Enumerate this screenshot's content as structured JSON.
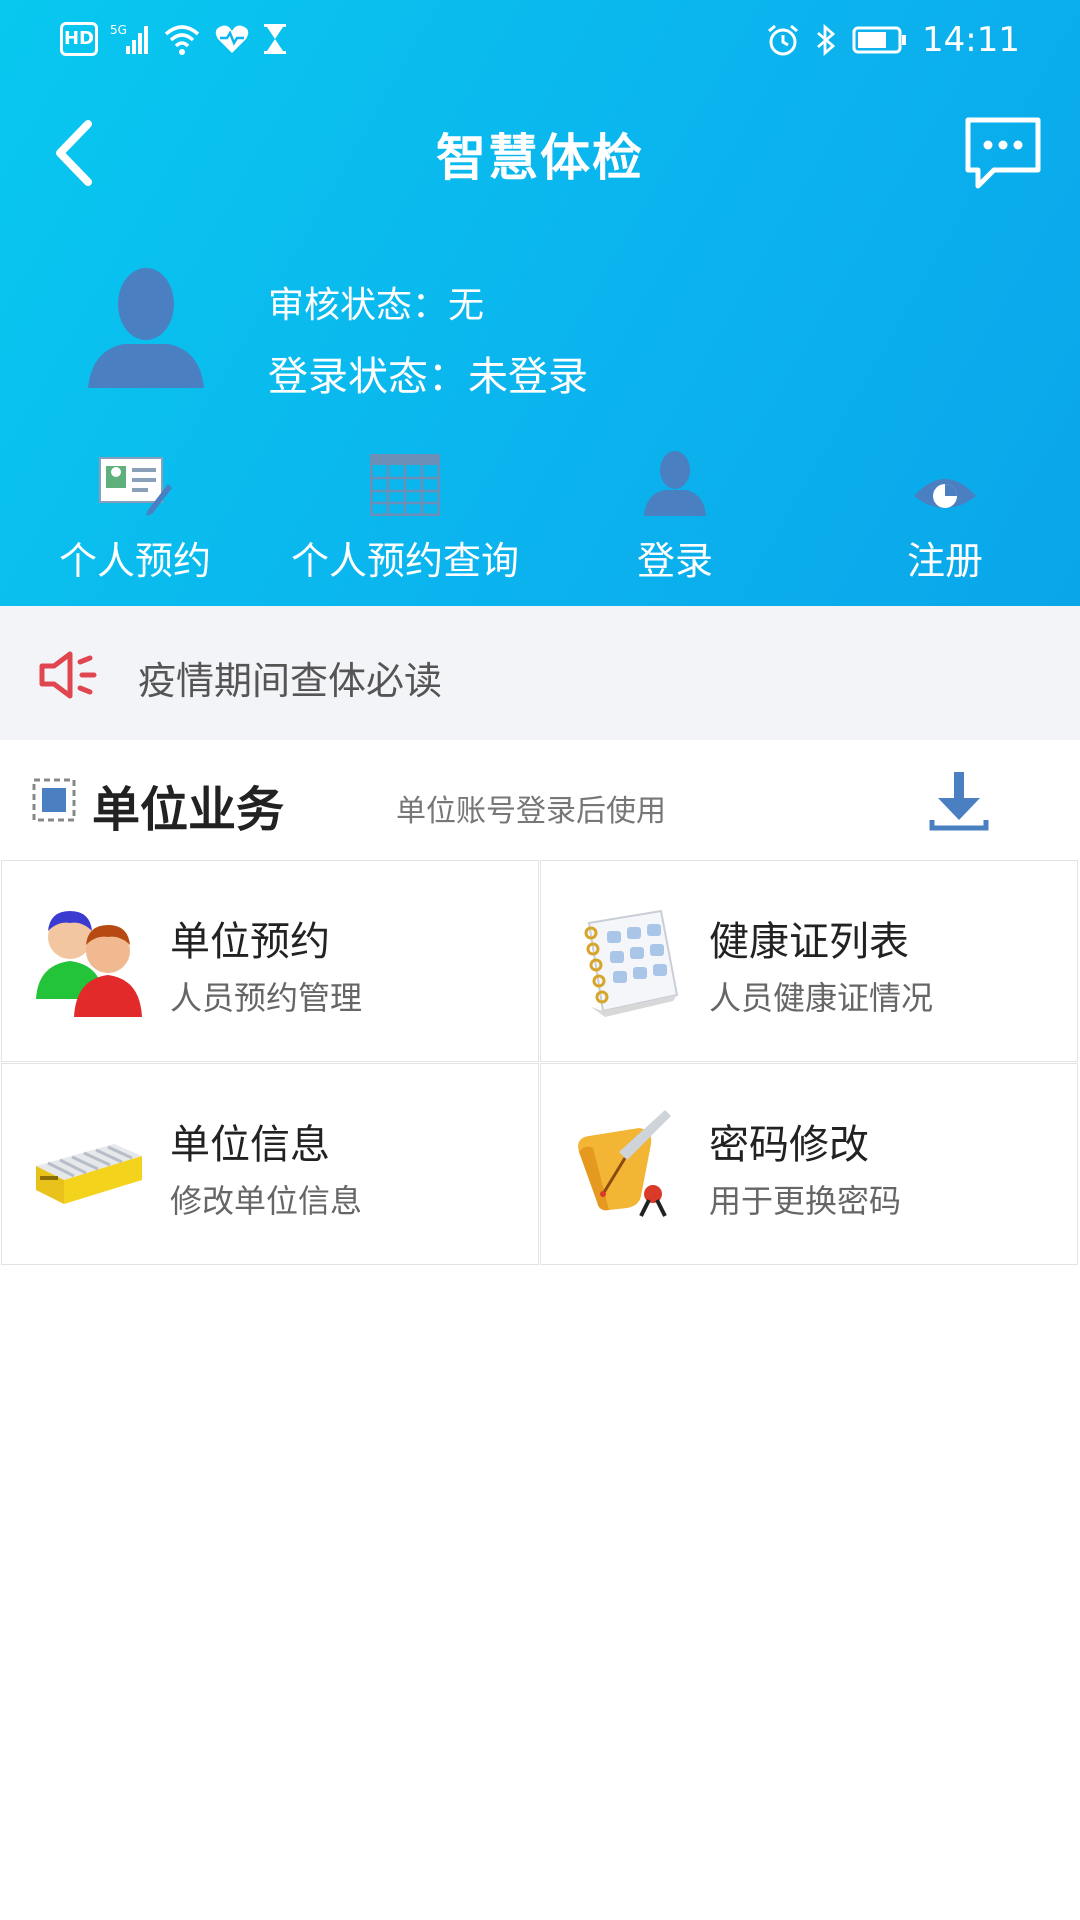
{
  "status_bar": {
    "left_icons": [
      "hd-icon",
      "5g-signal-icon",
      "wifi-icon",
      "health-icon",
      "hourglass-icon"
    ],
    "right_icons": [
      "alarm-icon",
      "bluetooth-icon",
      "battery-icon"
    ],
    "hd_label": "HD",
    "time": "14:11"
  },
  "nav": {
    "title": "智慧体检",
    "back_icon": "chevron-left-icon",
    "message_icon": "chat-bubble-icon"
  },
  "profile": {
    "audit_status": "审核状态：无",
    "login_status": "登录状态：未登录"
  },
  "quick_actions": [
    {
      "label": "个人预约",
      "icon": "id-card-edit-icon"
    },
    {
      "label": "个人预约查询",
      "icon": "calendar-grid-icon"
    },
    {
      "label": "登录",
      "icon": "user-icon"
    },
    {
      "label": "注册",
      "icon": "eye-icon"
    }
  ],
  "notice": {
    "text": "疫情期间查体必读",
    "icon": "speaker-icon"
  },
  "unit_section": {
    "title": "单位业务",
    "hint": "单位账号登录后使用",
    "download_icon": "download-icon"
  },
  "unit_items": [
    {
      "title": "单位预约",
      "subtitle": "人员预约管理",
      "icon": "people-icon"
    },
    {
      "title": "健康证列表",
      "subtitle": "人员健康证情况",
      "icon": "notebook-icon"
    },
    {
      "title": "单位信息",
      "subtitle": "修改单位信息",
      "icon": "hard-drive-icon"
    },
    {
      "title": "密码修改",
      "subtitle": "用于更换密码",
      "icon": "scroll-quill-icon"
    }
  ],
  "colors": {
    "header_top": "#08c8ef",
    "header_bottom": "#0aa6ea",
    "notice_bg": "#f3f4f8",
    "speaker_red": "#e0464f",
    "accent_blue": "#4a7fc1"
  }
}
